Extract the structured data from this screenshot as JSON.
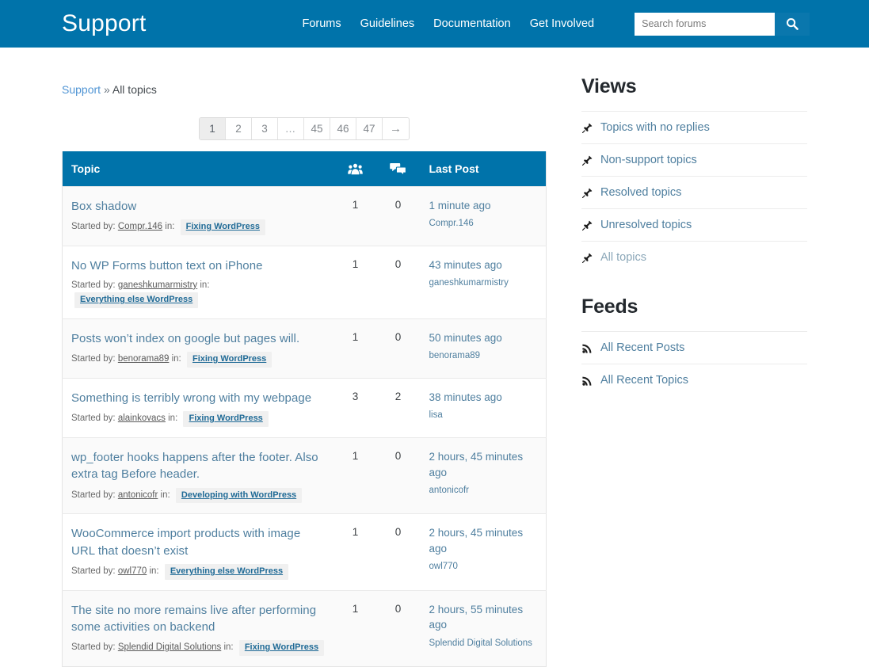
{
  "header": {
    "site_title": "Support",
    "brand_color": "#0073aa",
    "nav": [
      {
        "label": "Forums",
        "name": "nav-forums"
      },
      {
        "label": "Guidelines",
        "name": "nav-guidelines"
      },
      {
        "label": "Documentation",
        "name": "nav-documentation"
      },
      {
        "label": "Get Involved",
        "name": "nav-get-involved"
      }
    ],
    "search": {
      "placeholder": "Search forums",
      "value": "",
      "icon": "search-icon"
    }
  },
  "breadcrumb": {
    "root": "Support",
    "separator": "»",
    "current": "All topics"
  },
  "pagination": {
    "current": "1",
    "pages": [
      "1",
      "2",
      "3",
      "…",
      "45",
      "46",
      "47"
    ],
    "next": "→",
    "total_pages": 47
  },
  "table": {
    "columns": {
      "topic": "Topic",
      "voices_icon": "voices-group-icon",
      "replies_icon": "replies-bubbles-icon",
      "last_post": "Last Post"
    },
    "meta_prefix": "Started by:",
    "meta_in": "in:",
    "rows": [
      {
        "title": "Box shadow",
        "author": "Compr.146",
        "forum": "Fixing WordPress",
        "voices": "1",
        "replies": "0",
        "last_time": "1 minute ago",
        "last_author": "Compr.146"
      },
      {
        "title": "No WP Forms button text on iPhone",
        "author": "ganeshkumarmistry",
        "forum": "Everything else WordPress",
        "voices": "1",
        "replies": "0",
        "last_time": "43 minutes ago",
        "last_author": "ganeshkumarmistry"
      },
      {
        "title": "Posts won’t index on google but pages will.",
        "author": "benorama89",
        "forum": "Fixing WordPress",
        "voices": "1",
        "replies": "0",
        "last_time": "50 minutes ago",
        "last_author": "benorama89"
      },
      {
        "title": "Something is terribly wrong with my webpage",
        "author": "alainkovacs",
        "forum": "Fixing WordPress",
        "voices": "3",
        "replies": "2",
        "last_time": "38 minutes ago",
        "last_author": "lisa"
      },
      {
        "title": "wp_footer hooks happens after the footer. Also extra tag Before header.",
        "author": "antonicofr",
        "forum": "Developing with WordPress",
        "voices": "1",
        "replies": "0",
        "last_time": "2 hours, 45 minutes ago",
        "last_author": "antonicofr"
      },
      {
        "title": "WooCommerce import products with image URL that doesn’t exist",
        "author": "owl770",
        "forum": "Everything else WordPress",
        "voices": "1",
        "replies": "0",
        "last_time": "2 hours, 45 minutes ago",
        "last_author": "owl770"
      },
      {
        "title": "The site no more remains live after performing some activities on backend",
        "author": "Splendid Digital Solutions",
        "forum": "Fixing WordPress",
        "voices": "1",
        "replies": "0",
        "last_time": "2 hours, 55 minutes ago",
        "last_author": "Splendid Digital Solutions"
      }
    ]
  },
  "sidebar": {
    "views_heading": "Views",
    "views": [
      {
        "label": "Topics with no replies",
        "icon": "pushpin-icon",
        "active": false
      },
      {
        "label": "Non-support topics",
        "icon": "pushpin-icon",
        "active": false
      },
      {
        "label": "Resolved topics",
        "icon": "pushpin-icon",
        "active": false
      },
      {
        "label": "Unresolved topics",
        "icon": "pushpin-icon",
        "active": false
      },
      {
        "label": "All topics",
        "icon": "pushpin-icon",
        "active": true
      }
    ],
    "feeds_heading": "Feeds",
    "feeds": [
      {
        "label": "All Recent Posts",
        "icon": "rss-icon"
      },
      {
        "label": "All Recent Topics",
        "icon": "rss-icon"
      }
    ]
  }
}
